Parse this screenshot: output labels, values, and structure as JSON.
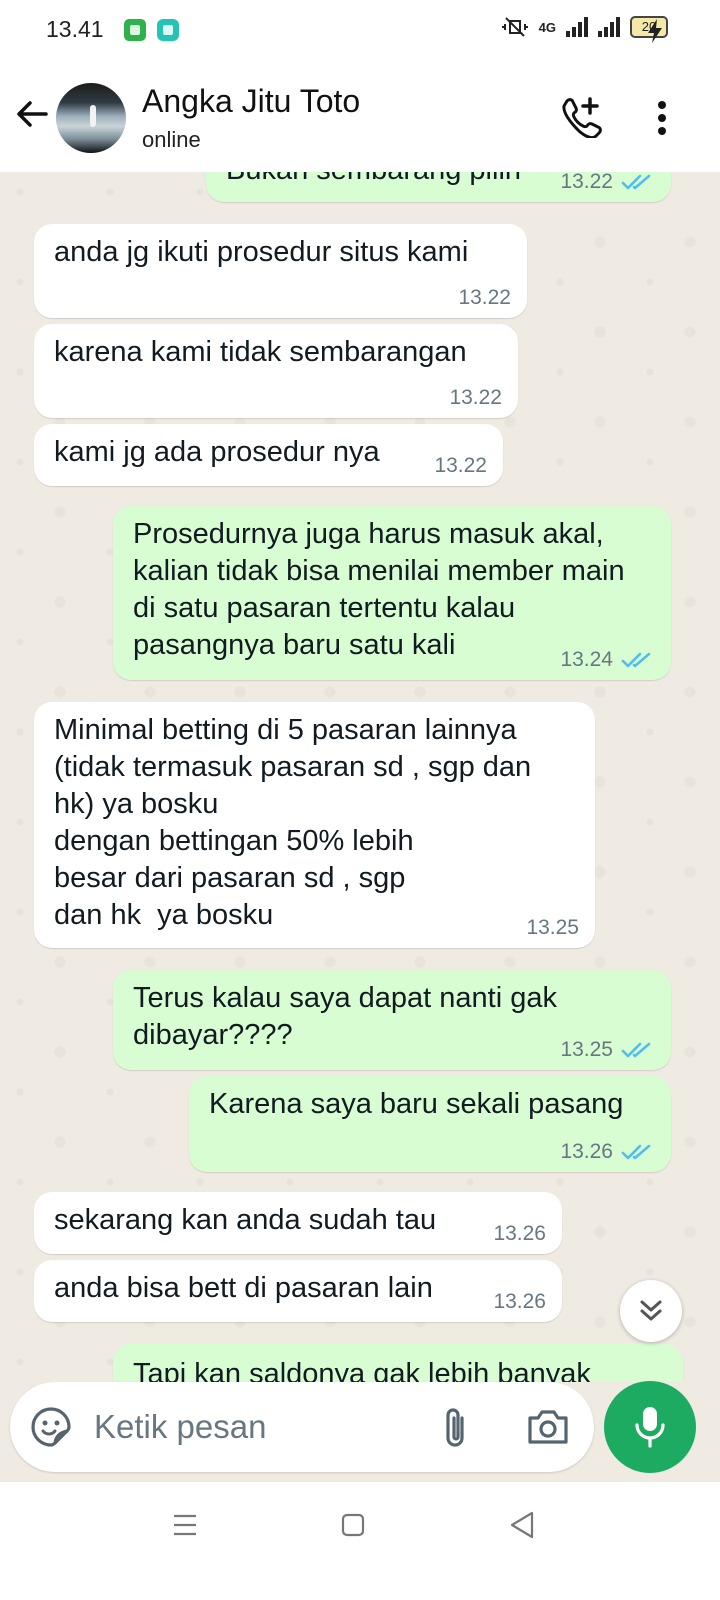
{
  "status_bar": {
    "time": "13.41",
    "network": "4G",
    "battery": "20"
  },
  "header": {
    "contact_name": "Angka Jitu Toto",
    "contact_status": "online"
  },
  "messages": [
    {
      "direction": "out",
      "text": "Bukan sembarang pilih",
      "time": "13.22",
      "read": true
    },
    {
      "direction": "in",
      "text": "anda jg ikuti prosedur situs kami",
      "time": "13.22"
    },
    {
      "direction": "in",
      "text": "karena kami tidak sembarangan",
      "time": "13.22"
    },
    {
      "direction": "in",
      "text": "kami jg ada prosedur nya",
      "time": "13.22"
    },
    {
      "direction": "out",
      "text": "Prosedurnya juga harus masuk akal, kalian tidak bisa menilai member main di satu pasaran tertentu kalau pasangnya baru satu kali",
      "time": "13.24",
      "read": true
    },
    {
      "direction": "in",
      "text": "Minimal betting di 5 pasaran lainnya (tidak termasuk pasaran sd , sgp dan hk) ya bosku\ndengan bettingan 50% lebih\nbesar dari pasaran sd , sgp\ndan hk  ya bosku",
      "time": "13.25"
    },
    {
      "direction": "out",
      "text": "Terus kalau saya dapat nanti gak dibayar????",
      "time": "13.25",
      "read": true
    },
    {
      "direction": "out",
      "text": "Karena saya baru sekali pasang",
      "time": "13.26",
      "read": true
    },
    {
      "direction": "in",
      "text": "sekarang kan anda sudah tau",
      "time": "13.26"
    },
    {
      "direction": "in",
      "text": "anda bisa bett di pasaran lain",
      "time": "13.26"
    },
    {
      "direction": "out",
      "text": "Tapi kan saldonya gak lebih banyak",
      "time": "",
      "read": true
    }
  ],
  "composer": {
    "placeholder": "Ketik pesan"
  },
  "colors": {
    "outgoing_bubble": "#d9fdd3",
    "incoming_bubble": "#ffffff",
    "accent": "#1daa61",
    "read_tick": "#53bdeb",
    "chat_background": "#efeae2"
  },
  "icons": [
    "back-arrow-icon",
    "add-call-icon",
    "more-menu-icon",
    "double-tick-icon",
    "scroll-down-icon",
    "sticker-icon",
    "paperclip-icon",
    "camera-icon",
    "microphone-icon",
    "nav-menu-icon",
    "nav-home-icon",
    "nav-back-icon"
  ]
}
